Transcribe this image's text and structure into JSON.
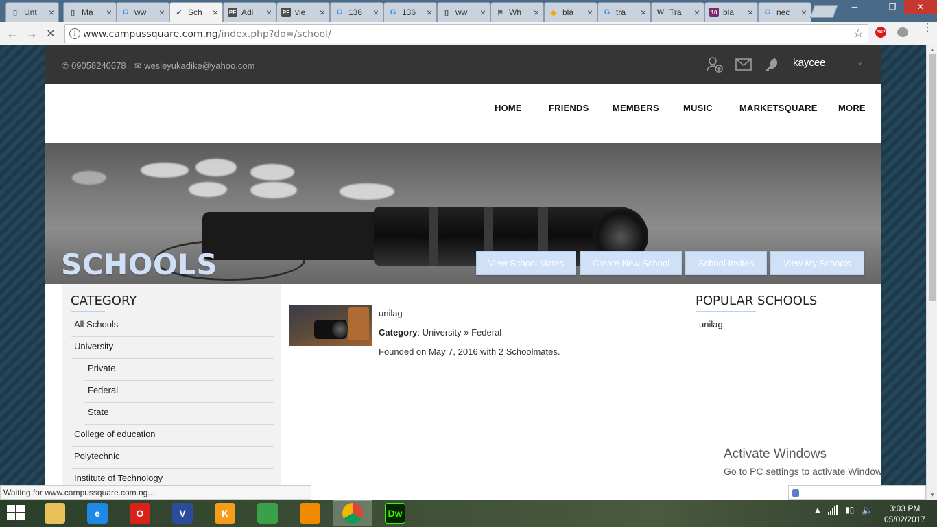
{
  "browser": {
    "tabs": [
      {
        "label": "Unt",
        "favicon": "doc-icon",
        "color": "#ffffff"
      },
      {
        "label": "Ma",
        "favicon": "doc-icon",
        "color": "#ffffff"
      },
      {
        "label": "ww",
        "favicon": "google-icon",
        "color": "#4285f4"
      },
      {
        "label": "Sch",
        "favicon": "site-icon",
        "color": "#2b5797"
      },
      {
        "label": "Adi",
        "favicon": "pf-icon",
        "color": "#4d4d4d"
      },
      {
        "label": "vie",
        "favicon": "pf-icon",
        "color": "#4d4d4d"
      },
      {
        "label": "136",
        "favicon": "google-icon",
        "color": "#4285f4"
      },
      {
        "label": "136",
        "favicon": "google-icon",
        "color": "#4285f4"
      },
      {
        "label": "ww",
        "favicon": "doc-icon",
        "color": "#ffffff"
      },
      {
        "label": "Wh",
        "favicon": "whatsapp-icon",
        "color": "#666666"
      },
      {
        "label": "bla",
        "favicon": "puzzle-icon",
        "color": "#f2a900"
      },
      {
        "label": "tra",
        "favicon": "google-icon",
        "color": "#4285f4"
      },
      {
        "label": "Tra",
        "favicon": "wikipedia-icon",
        "color": "#ffffff"
      },
      {
        "label": "bla",
        "favicon": "ten-icon",
        "color": "#7b2a6e"
      },
      {
        "label": "nec",
        "favicon": "google-icon",
        "color": "#4285f4"
      }
    ],
    "active_tab_index": 3,
    "url_host": "www.campussquare.com.ng",
    "url_path": "/index.php?do=/school/",
    "status_text": "Waiting for www.campussquare.com.ng..."
  },
  "topbar": {
    "phone": "09058240678",
    "email": "wesleyukadike@yahoo.com",
    "username": "kaycee"
  },
  "nav": [
    "HOME",
    "FRIENDS",
    "MEMBERS",
    "MUSIC",
    "MARKETSQUARE",
    "MORE"
  ],
  "hero": {
    "title": "SCHOOLS",
    "buttons": [
      "View School Mates",
      "Create New School",
      "School Invites",
      "View My Schools"
    ]
  },
  "sidebar": {
    "heading": "CATEGORY",
    "items": [
      {
        "label": "All Schools",
        "level": 0
      },
      {
        "label": "University",
        "level": 0
      },
      {
        "label": "Private",
        "level": 1
      },
      {
        "label": "Federal",
        "level": 1
      },
      {
        "label": "State",
        "level": 1
      },
      {
        "label": "College of education",
        "level": 0
      },
      {
        "label": "Polytechnic",
        "level": 0
      },
      {
        "label": "Institute of Technology",
        "level": 0
      }
    ]
  },
  "school": {
    "name": "unilag",
    "category_label": "Category",
    "category_value": "University » Federal",
    "founded": "Founded on May 7, 2016 with 2 Schoolmates."
  },
  "popular": {
    "heading": "POPULAR SCHOOLS",
    "items": [
      "unilag"
    ]
  },
  "watermark": {
    "line1": "Activate Windows",
    "line2": "Go to PC settings to activate Windows."
  },
  "taskbar": {
    "apps": [
      {
        "name": "file-explorer-icon",
        "color": "#e8c15a",
        "text": ""
      },
      {
        "name": "internet-explorer-icon",
        "color": "#1e88e5",
        "text": "e"
      },
      {
        "name": "opera-icon",
        "color": "#d9231a",
        "text": "O"
      },
      {
        "name": "visio-icon",
        "color": "#2b4c9a",
        "text": "V"
      },
      {
        "name": "kmplayer-icon",
        "color": "#f59c1a",
        "text": "K"
      },
      {
        "name": "idm-icon",
        "color": "#3aa04a",
        "text": ""
      },
      {
        "name": "vlc-icon",
        "color": "#f08a00",
        "text": ""
      },
      {
        "name": "chrome-icon",
        "color": "#db4437",
        "text": ""
      },
      {
        "name": "dreamweaver-icon",
        "color": "#35fa00",
        "text": "Dw"
      }
    ],
    "active_app_index": 7,
    "time": "3:03 PM",
    "date": "05/02/2017"
  },
  "colors": {
    "topbar": "#353535",
    "hero_button": "#cfe0f7",
    "hero_title": "#cfe0f6",
    "accent_line": "#b9d3ec"
  }
}
